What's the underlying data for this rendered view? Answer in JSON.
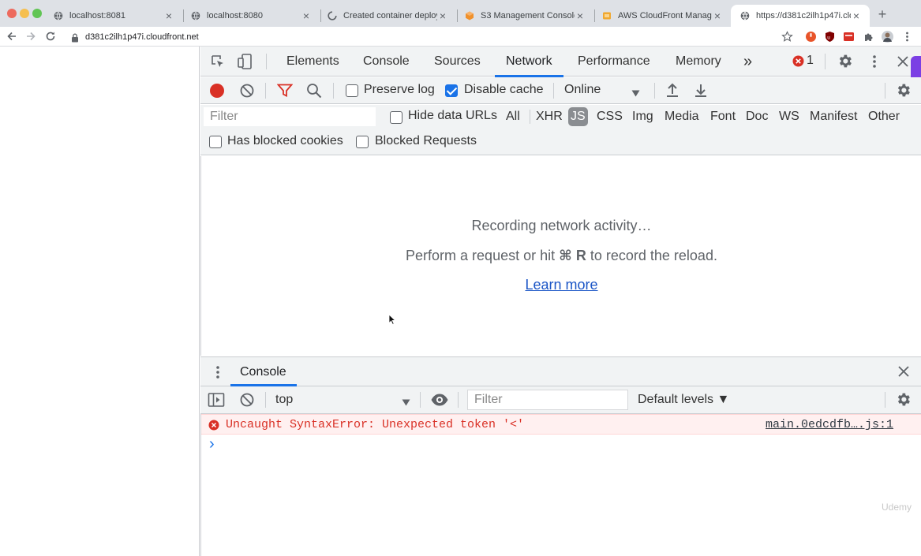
{
  "browser": {
    "tabs": [
      {
        "title": "localhost:8081",
        "active": false
      },
      {
        "title": "localhost:8080",
        "active": false
      },
      {
        "title": "Created container deploy sc",
        "active": false
      },
      {
        "title": "S3 Management Console",
        "active": false
      },
      {
        "title": "AWS CloudFront Manageme",
        "active": false
      },
      {
        "title": "https://d381c2ilh1p47i.cloudi",
        "active": true
      }
    ],
    "close_glyph": "×",
    "newtab_glyph": "+",
    "url": "d381c2ilh1p47i.cloudfront.net"
  },
  "devtools": {
    "tabs": [
      "Elements",
      "Console",
      "Sources",
      "Network",
      "Performance",
      "Memory"
    ],
    "active_tab": "Network",
    "more_glyph": "»",
    "error_count": "1",
    "network": {
      "preserve_log": {
        "label": "Preserve log",
        "checked": false
      },
      "disable_cache": {
        "label": "Disable cache",
        "checked": true
      },
      "throttling": "Online",
      "filter_placeholder": "Filter",
      "hide_data_urls": {
        "label": "Hide data URLs",
        "checked": false
      },
      "types": [
        "All",
        "XHR",
        "JS",
        "CSS",
        "Img",
        "Media",
        "Font",
        "Doc",
        "WS",
        "Manifest",
        "Other"
      ],
      "active_type": "JS",
      "has_blocked_cookies": {
        "label": "Has blocked cookies",
        "checked": false
      },
      "blocked_requests": {
        "label": "Blocked Requests",
        "checked": false
      },
      "empty_title": "Recording network activity…",
      "empty_hint_pre": "Perform a request or hit",
      "empty_hint_keys": "⌘ R",
      "empty_hint_post": "to record the reload.",
      "learn_more": "Learn more"
    },
    "drawer": {
      "tab": "Console",
      "context": "top",
      "filter_placeholder": "Filter",
      "levels": "Default levels ▼",
      "error_message": "Uncaught SyntaxError: Unexpected token '<'",
      "error_source": "main.0edcdfb….js:1",
      "prompt": "›"
    }
  },
  "watermark": "Udemy",
  "colors": {
    "accent": "#1a73e8",
    "error_red": "#d93025",
    "record_red": "#d93025"
  }
}
